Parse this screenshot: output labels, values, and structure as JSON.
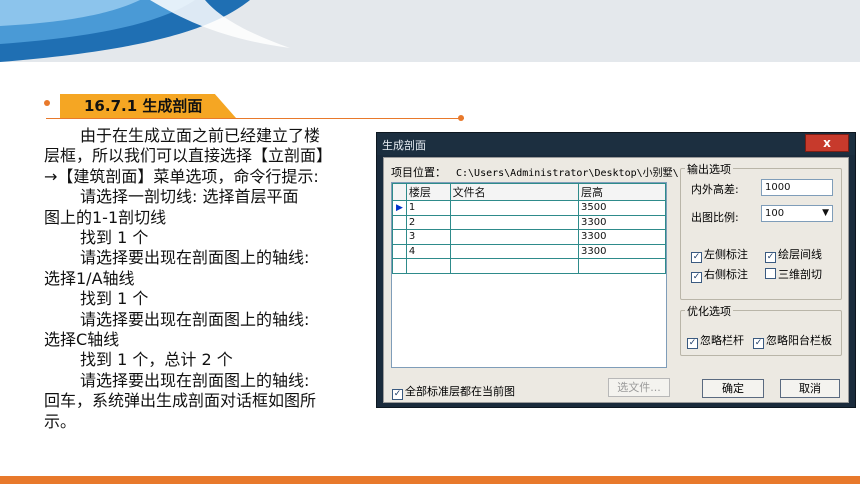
{
  "slide": {
    "heading": "16.7.1 生成剖面",
    "paragraphs": [
      {
        "text": "由于在生成立面之前已经建立了楼",
        "indent": true
      },
      {
        "text": "层框，所以我们可以直接选择【立剖面】",
        "indent": false
      },
      {
        "text": "→【建筑剖面】菜单选项，命令行提示:",
        "indent": false
      },
      {
        "text": "请选择一剖切线:      选择首层平面",
        "indent": true
      },
      {
        "text": "图上的1-1剖切线",
        "indent": false
      },
      {
        "text": "找到 1 个",
        "indent": true
      },
      {
        "text": "请选择要出现在剖面图上的轴线:",
        "indent": true
      },
      {
        "text": "选择1/A轴线",
        "indent": false
      },
      {
        "text": "找到 1 个",
        "indent": true
      },
      {
        "text": "请选择要出现在剖面图上的轴线:",
        "indent": true
      },
      {
        "text": "选择C轴线",
        "indent": false
      },
      {
        "text": "找到 1 个，总计 2 个",
        "indent": true
      },
      {
        "text": "请选择要出现在剖面图上的轴线:",
        "indent": true
      },
      {
        "text": "回车，系统弹出生成剖面对话框如图所",
        "indent": false
      },
      {
        "text": "示。",
        "indent": false
      }
    ]
  },
  "dialog": {
    "title": "生成剖面",
    "close_label": "x",
    "path_label": "项目位置：",
    "path_value": "C:\\Users\\Administrator\\Desktop\\小别墅\\",
    "grid": {
      "columns": [
        "楼层",
        "文件名",
        "层高"
      ],
      "rows": [
        {
          "floor": "1",
          "file": "",
          "height": "3500",
          "selected": true
        },
        {
          "floor": "2",
          "file": "",
          "height": "3300",
          "selected": false
        },
        {
          "floor": "3",
          "file": "",
          "height": "3300",
          "selected": false
        },
        {
          "floor": "4",
          "file": "",
          "height": "3300",
          "selected": false
        },
        {
          "floor": "",
          "file": "",
          "height": "",
          "selected": false
        }
      ],
      "selection_marker": "▶"
    },
    "all_floors_label": "全部标准层都在当前图",
    "all_floors_checked": true,
    "choose_file_label": "选文件...",
    "output": {
      "title": "输出选项",
      "height_diff_label": "内外高差:",
      "height_diff_value": "1000",
      "scale_label": "出图比例:",
      "scale_value": "100",
      "left_label": "左侧标注",
      "left_checked": true,
      "floor_lines_label": "绘层间线",
      "floor_lines_checked": true,
      "right_label": "右侧标注",
      "right_checked": true,
      "three_d_label": "三维剖切",
      "three_d_checked": false
    },
    "optimize": {
      "title": "优化选项",
      "ignore_rail_label": "忽略栏杆",
      "ignore_rail_checked": true,
      "ignore_balcony_label": "忽略阳台栏板",
      "ignore_balcony_checked": true
    },
    "ok_label": "确定",
    "cancel_label": "取消"
  },
  "colors": {
    "accent_orange": "#e8792b",
    "heading_tag": "#f5a623",
    "wave_blue": "#1f6fb3"
  }
}
